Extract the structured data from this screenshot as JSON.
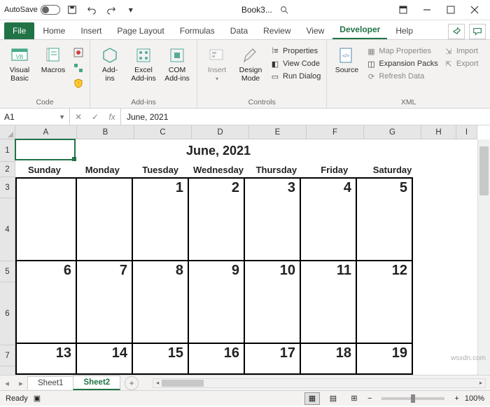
{
  "titlebar": {
    "autosave_label": "AutoSave",
    "autosave_state": "Off",
    "doc_name": "Book3..."
  },
  "tabs": {
    "file": "File",
    "items": [
      "Home",
      "Insert",
      "Page Layout",
      "Formulas",
      "Data",
      "Review",
      "View",
      "Developer",
      "Help"
    ],
    "active": "Developer"
  },
  "ribbon": {
    "code": {
      "visual_basic": "Visual\nBasic",
      "macros": "Macros",
      "label": "Code"
    },
    "addins": {
      "addins": "Add-\nins",
      "excel_addins": "Excel\nAdd-ins",
      "com_addins": "COM\nAdd-ins",
      "label": "Add-ins"
    },
    "controls": {
      "insert": "Insert",
      "design_mode": "Design\nMode",
      "properties": "Properties",
      "view_code": "View Code",
      "run_dialog": "Run Dialog",
      "label": "Controls"
    },
    "xml": {
      "source": "Source",
      "map_properties": "Map Properties",
      "expansion_packs": "Expansion Packs",
      "refresh_data": "Refresh Data",
      "import": "Import",
      "export": "Export",
      "label": "XML"
    }
  },
  "formula_bar": {
    "name_box": "A1",
    "fx": "fx",
    "value": "June, 2021"
  },
  "grid": {
    "columns": [
      "A",
      "B",
      "C",
      "D",
      "E",
      "F",
      "G",
      "H",
      "I"
    ],
    "rows": [
      "1",
      "2",
      "3",
      "4",
      "5",
      "6",
      "7"
    ],
    "active_cell": "A1"
  },
  "calendar": {
    "title": "June, 2021",
    "days": [
      "Sunday",
      "Monday",
      "Tuesday",
      "Wednesday",
      "Thursday",
      "Friday",
      "Saturday"
    ],
    "week1": [
      "",
      "",
      "1",
      "2",
      "3",
      "4",
      "5"
    ],
    "week2": [
      "6",
      "7",
      "8",
      "9",
      "10",
      "11",
      "12"
    ],
    "week3": [
      "13",
      "14",
      "15",
      "16",
      "17",
      "18",
      "19"
    ]
  },
  "sheets": {
    "items": [
      "Sheet1",
      "Sheet2"
    ],
    "active": "Sheet2"
  },
  "statusbar": {
    "ready": "Ready",
    "zoom": "100%"
  },
  "watermark": "wsxdn.com"
}
